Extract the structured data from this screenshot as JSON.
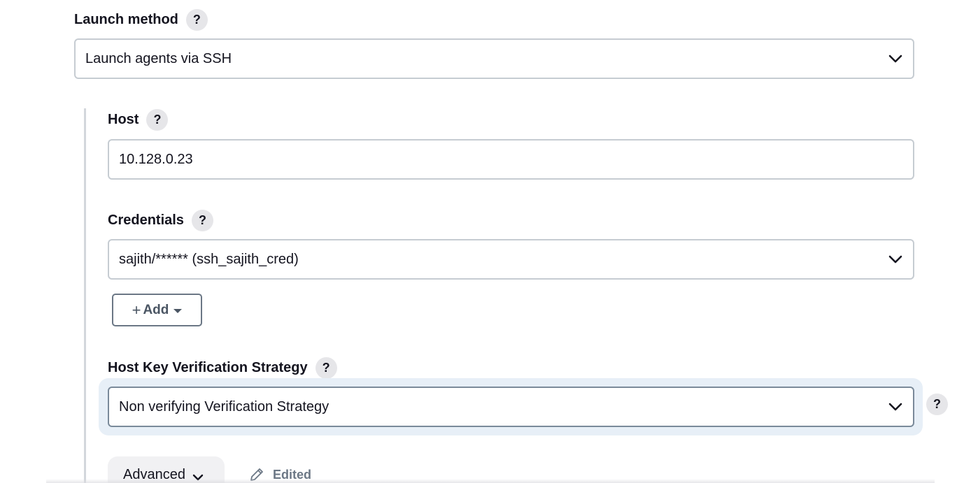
{
  "launch_method": {
    "label": "Launch method",
    "help": "?",
    "selected": "Launch agents via SSH"
  },
  "host": {
    "label": "Host",
    "help": "?",
    "value": "10.128.0.23"
  },
  "credentials": {
    "label": "Credentials",
    "help": "?",
    "selected": "sajith/****** (ssh_sajith_cred)",
    "add_button": {
      "plus": "+",
      "label": "Add"
    }
  },
  "host_key_verification": {
    "label": "Host Key Verification Strategy",
    "help": "?",
    "selected": "Non verifying Verification Strategy",
    "side_help": "?"
  },
  "advanced": {
    "label": "Advanced",
    "edited_label": "Edited"
  },
  "icons": {
    "dropdown": "chevron-down-icon",
    "help": "question-mark-icon",
    "edited": "pencil-icon"
  }
}
